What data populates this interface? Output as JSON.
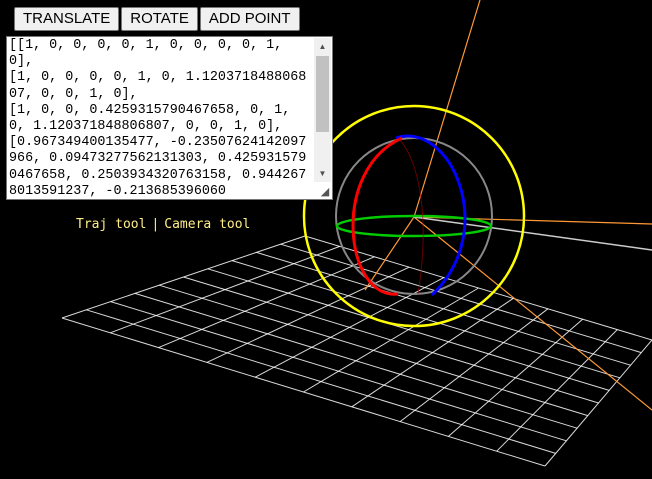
{
  "toolbar": {
    "translate_label": "TRANSLATE",
    "rotate_label": "ROTATE",
    "add_point_label": "ADD POINT"
  },
  "matrix_textarea": {
    "value": "[[1, 0, 0, 0, 0, 1, 0, 0, 0, 0, 1, 0],\n[1, 0, 0, 0, 0, 1, 0, 1.120371848806807, 0, 0, 1, 0],\n[1, 0, 0, 0.4259315790467658, 0, 1, 0, 1.120371848806807, 0, 0, 1, 0],\n[0.967349400135477, -0.23507624142097966, 0.09473277562131303, 0.4259315790467658, 0.2503934320763158, 0.9442678013591237, -0.213685396060"
  },
  "tool_links": {
    "traj_tool": "Traj tool",
    "separator": "|",
    "camera_tool": "Camera tool"
  },
  "scene": {
    "colors": {
      "background": "#000000",
      "grid": "#ffffff",
      "gizmo_outer_ring": "#ffff00",
      "gizmo_inner_ring": "#888888",
      "rotate_x_ring": "#ff0000",
      "rotate_y_ring": "#00cc00",
      "rotate_z_ring": "#0000ff",
      "trajectory_lines": "#ff9933",
      "axis_line": "#cccccc"
    }
  }
}
